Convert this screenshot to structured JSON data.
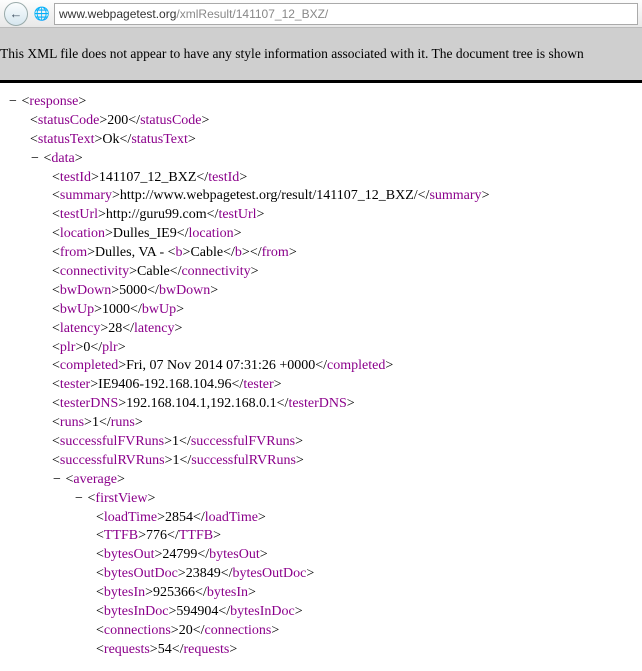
{
  "nav": {
    "back_glyph": "←",
    "globe_glyph": "🌐",
    "url_host": "www.webpagetest.org",
    "url_path": "/xmlResult/141107_12_BXZ/"
  },
  "notice": "This XML file does not appear to have any style information associated with it. The document tree is shown",
  "xml": {
    "root": "response",
    "statusCode": "200",
    "statusText": "Ok",
    "data": {
      "testId": "141107_12_BXZ",
      "summary": "http://www.webpagetest.org/result/141107_12_BXZ/",
      "testUrl": "http://guru99.com",
      "location": "Dulles_IE9",
      "from_pre": "Dulles, VA - ",
      "from_bold": "Cable",
      "connectivity": "Cable",
      "bwDown": "5000",
      "bwUp": "1000",
      "latency": "28",
      "plr": "0",
      "completed": "Fri, 07 Nov 2014 07:31:26 +0000",
      "tester": "IE9406-192.168.104.96",
      "testerDNS": "192.168.104.1,192.168.0.1",
      "runs": "1",
      "successfulFVRuns": "1",
      "successfulRVRuns": "1",
      "average": {
        "firstView": {
          "loadTime": "2854",
          "TTFB": "776",
          "bytesOut": "24799",
          "bytesOutDoc": "23849",
          "bytesIn": "925366",
          "bytesInDoc": "594904",
          "connections": "20",
          "requests": "54"
        }
      }
    }
  }
}
